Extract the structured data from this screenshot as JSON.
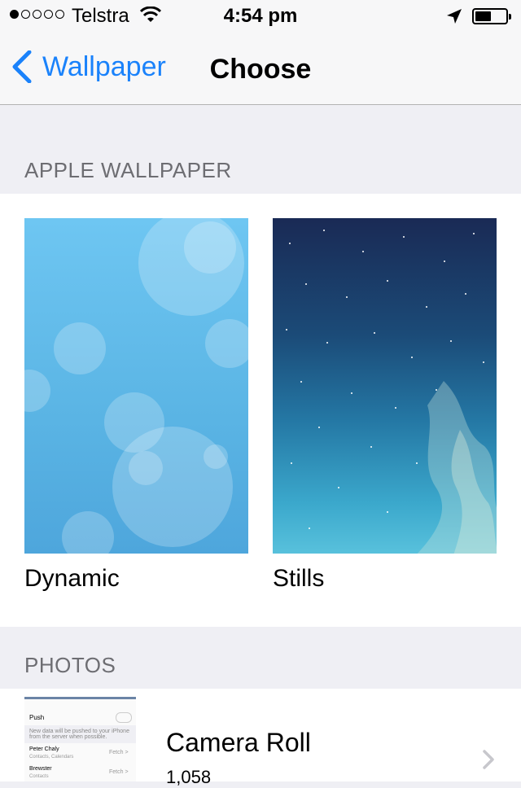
{
  "status": {
    "carrier": "Telstra",
    "time": "4:54 pm",
    "signal_filled": 1,
    "signal_total": 5,
    "battery_level": 0.5
  },
  "nav": {
    "back_label": "Wallpaper",
    "title": "Choose"
  },
  "sections": {
    "apple_header": "APPLE WALLPAPER",
    "photos_header": "PHOTOS"
  },
  "wallpapers": [
    {
      "label": "Dynamic"
    },
    {
      "label": "Stills"
    }
  ],
  "photos": {
    "camera_roll_label": "Camera Roll",
    "camera_roll_count": "1,058",
    "thumb_lines": [
      "Push",
      "New data will be pushed to your iPhone from the server when possible.",
      "Peter Chaly",
      "Contacts, Calendars",
      "Fetch >",
      "Brewster",
      "Contacts",
      "Fetch >"
    ]
  },
  "colors": {
    "accent": "#1a82fb",
    "header_text": "#6d6d72",
    "background": "#efeff4"
  }
}
